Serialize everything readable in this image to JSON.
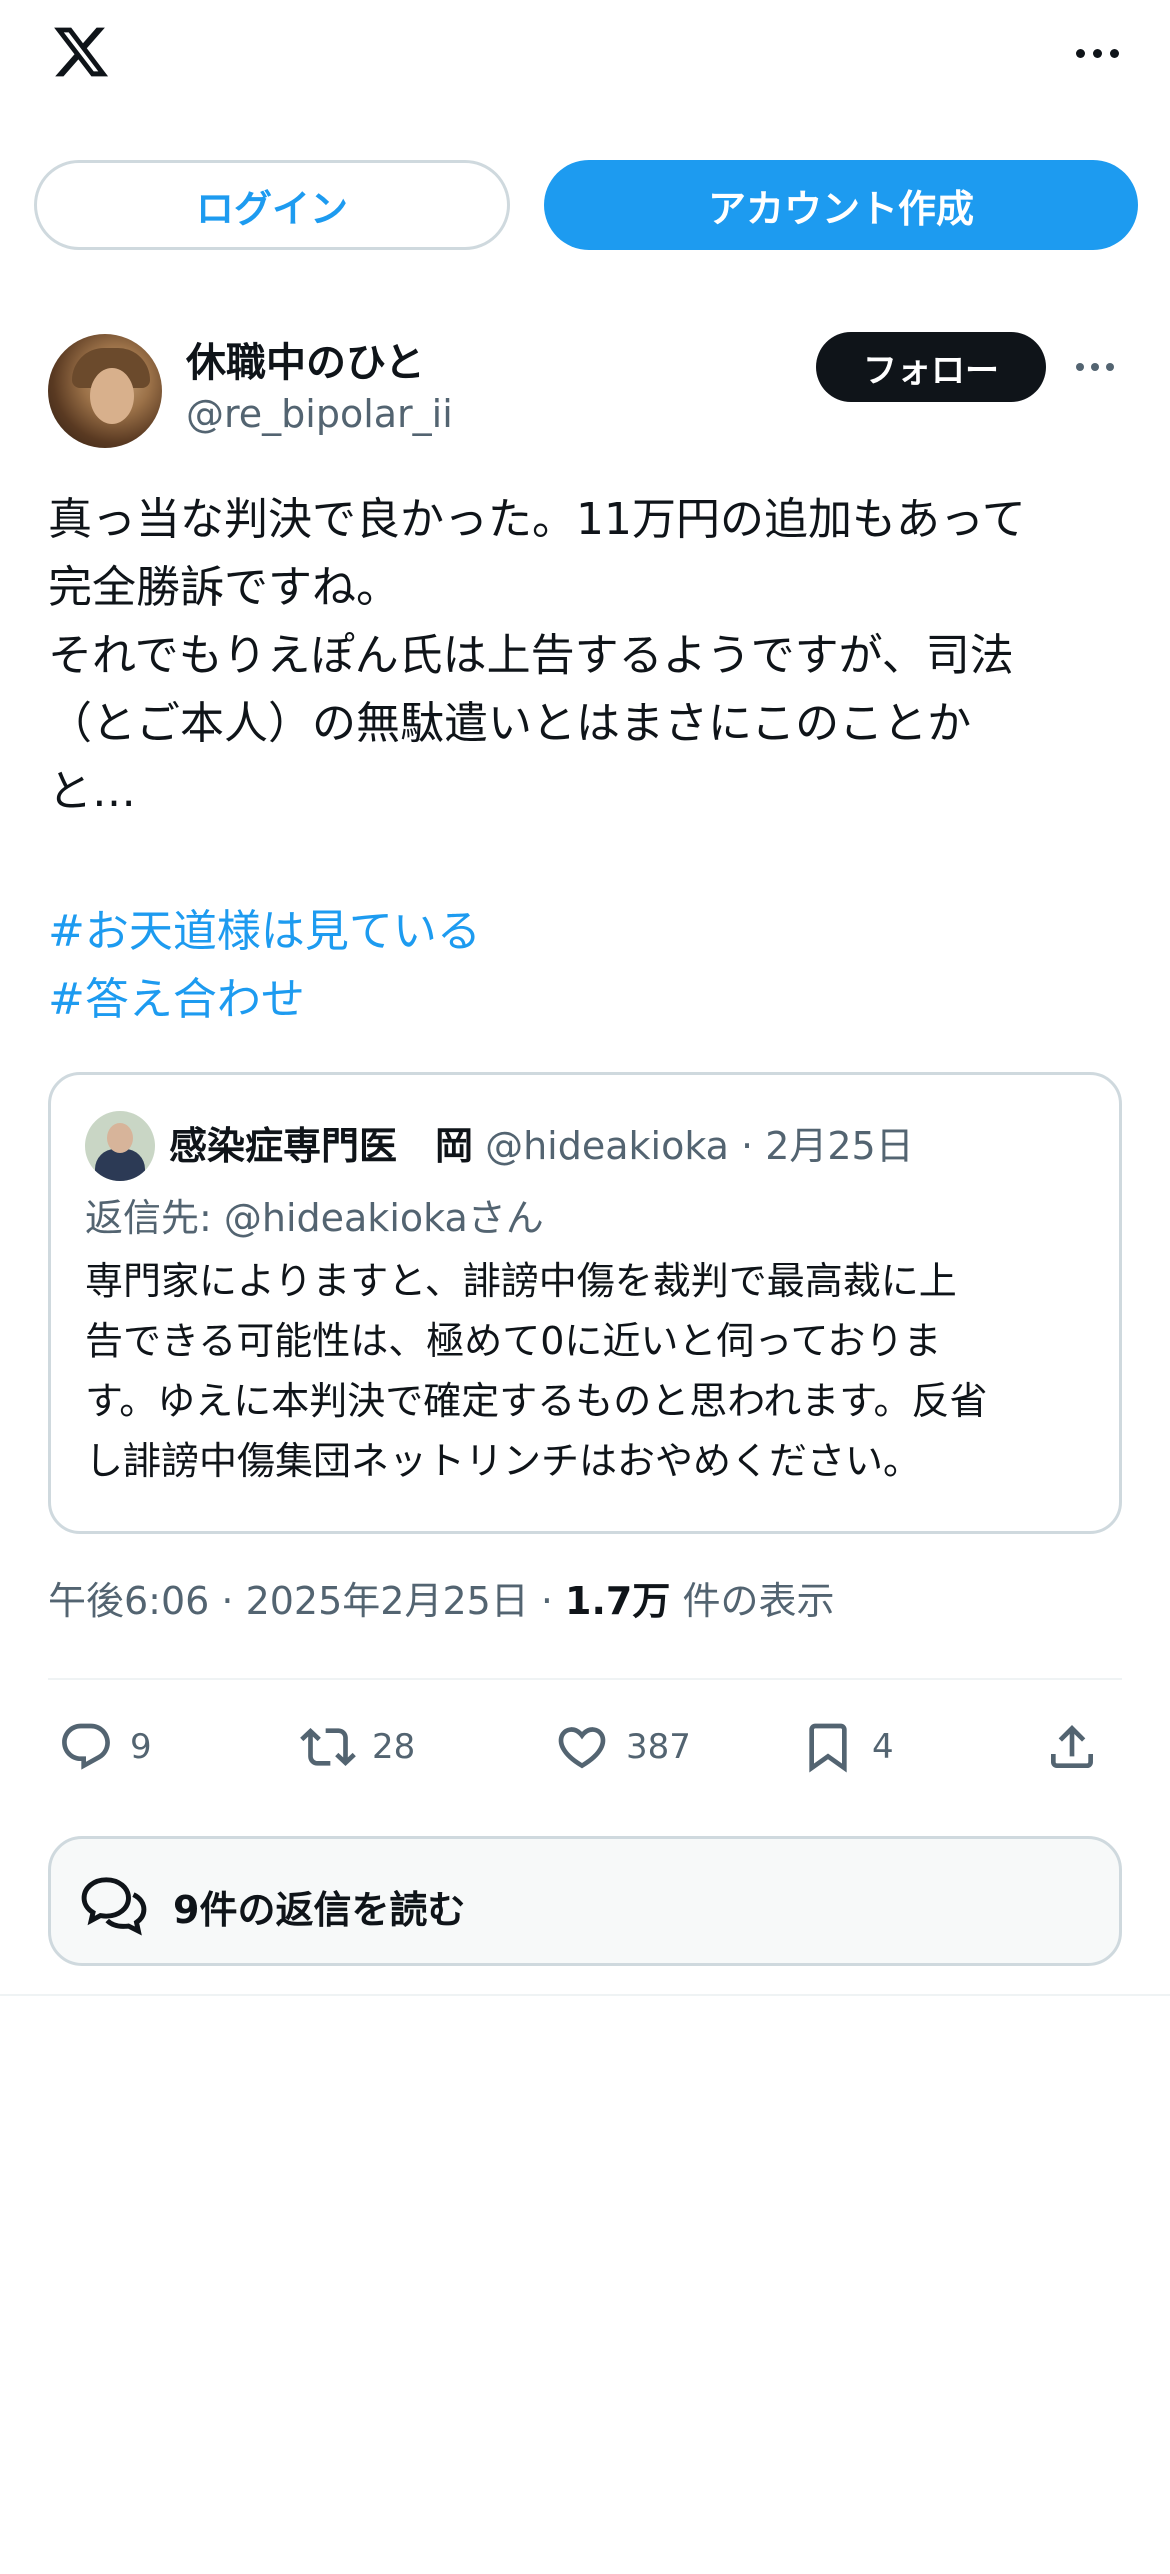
{
  "topbar": {
    "logo_icon": "x-logo-icon",
    "more_icon": "more-horizontal-icon"
  },
  "auth": {
    "login_label": "ログイン",
    "signup_label": "アカウント作成"
  },
  "author": {
    "name": "休職中のひと",
    "handle": "@re_bipolar_ii",
    "follow_label": "フォロー"
  },
  "tweet": {
    "lines": [
      "真っ当な判決で良かった。11万円の追加もあって",
      "完全勝訴ですね。",
      "それでもりえぽん氏は上告するようですが、司法",
      "（とご本人）の無駄遣いとはまさにこのことか",
      "と…"
    ],
    "hashtags": [
      "#お天道様は見ている",
      "#答え合わせ"
    ]
  },
  "quote": {
    "name": "感染症専門医　岡",
    "meta": " @hideakioka · 2月25日",
    "reply_to": "返信先: @hideakiokaさん",
    "lines": [
      "専門家によりますと、誹謗中傷を裁判で最高裁に上",
      "告できる可能性は、極めて0に近いと伺っておりま",
      "す。ゆえに本判決で確定するものと思われます。反省",
      "し誹謗中傷集団ネットリンチはおやめください。"
    ]
  },
  "meta": {
    "time": "午後6:06 · 2025年2月25日 · ",
    "views": "1.7万",
    "views_label": " 件の表示"
  },
  "actions": {
    "replies": "9",
    "retweets": "28",
    "likes": "387",
    "bookmarks": "4"
  },
  "read_replies_label": "9件の返信を読む",
  "colors": {
    "accent": "#1d9bf0",
    "text": "#0f1419",
    "muted": "#536471",
    "border": "#cfd9de"
  }
}
